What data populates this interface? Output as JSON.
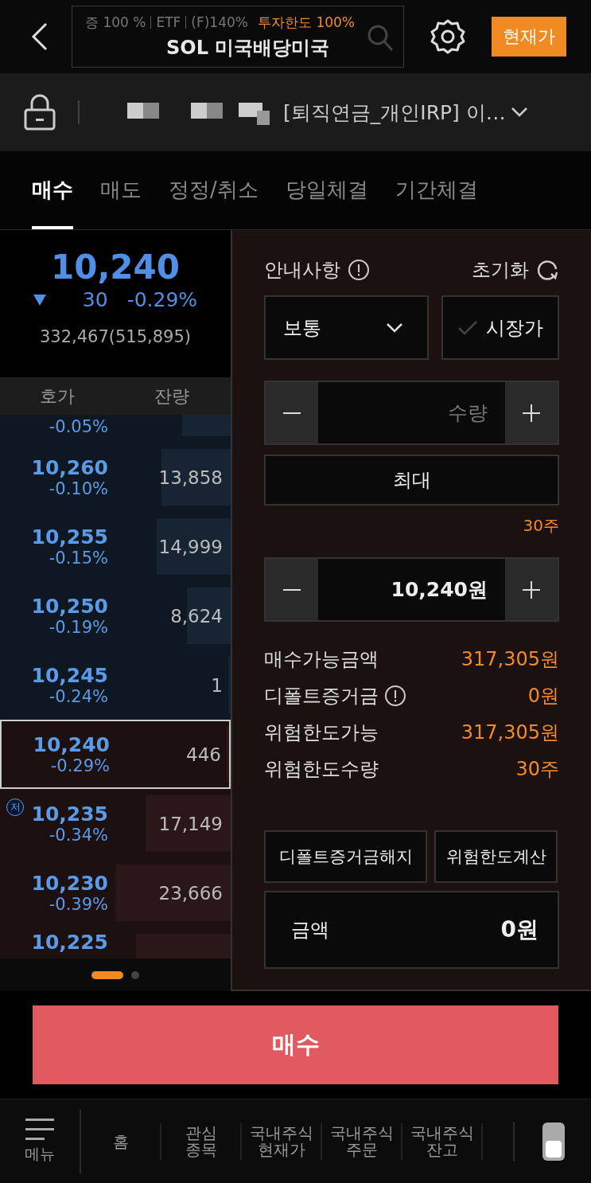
{
  "header": {
    "info": [
      "증 100 %",
      "ETF",
      "(F)140%"
    ],
    "limit": "투자한도 100%",
    "stock_name": "SOL 미국배당미국",
    "current_price_button": "현재가"
  },
  "account": {
    "masked": true,
    "name": "[퇴직연금_개인IRP] 이…"
  },
  "tabs": [
    {
      "label": "매수",
      "selected": true
    },
    {
      "label": "매도",
      "selected": false
    },
    {
      "label": "정정/취소",
      "selected": false
    },
    {
      "label": "당일체결",
      "selected": false
    },
    {
      "label": "기간체결",
      "selected": false
    }
  ],
  "quote": {
    "price": "10,240",
    "change": "30",
    "change_rate": "-0.29%",
    "volume": "332,467(515,895)"
  },
  "orderbook": {
    "columns": [
      "호가",
      "잔량"
    ],
    "rows": [
      {
        "kind": "ask",
        "pct": "-0.05%",
        "level": 0.21,
        "selected": false
      },
      {
        "kind": "ask",
        "price": "10,260",
        "pct": "-0.10%",
        "volume": "13,858",
        "level": 0.3,
        "selected": false
      },
      {
        "kind": "ask",
        "price": "10,255",
        "pct": "-0.15%",
        "volume": "14,999",
        "level": 0.32,
        "selected": false
      },
      {
        "kind": "ask",
        "price": "10,250",
        "pct": "-0.19%",
        "volume": "8,624",
        "level": 0.19,
        "selected": false
      },
      {
        "kind": "ask",
        "price": "10,245",
        "pct": "-0.24%",
        "volume": "1",
        "level": 0.01,
        "selected": false
      },
      {
        "kind": "bid",
        "price": "10,240",
        "pct": "-0.29%",
        "volume": "446",
        "level": 0.01,
        "selected": true
      },
      {
        "kind": "bid",
        "badge": "저",
        "price": "10,235",
        "pct": "-0.34%",
        "volume": "17,149",
        "level": 0.37,
        "selected": false
      },
      {
        "kind": "bid",
        "price": "10,230",
        "pct": "-0.39%",
        "volume": "23,666",
        "level": 0.5,
        "selected": false
      },
      {
        "kind": "bid",
        "price": "10,225",
        "level": 0.41,
        "selected": false
      }
    ]
  },
  "pager": [
    {
      "selected": true
    },
    {
      "selected": false
    }
  ],
  "order": {
    "notice": "안내사항",
    "reset": "초기화",
    "order_type": "보통",
    "market_price": {
      "label": "시장가",
      "checked": false
    },
    "quantity": {
      "placeholder": "수량"
    },
    "max_button": "최대",
    "max_quantity": "30주",
    "price": {
      "value": "10,240원"
    },
    "info": [
      {
        "label": "매수가능금액",
        "value": "317,305원",
        "info_icon": false
      },
      {
        "label": "디폴트증거금",
        "value": "0원",
        "info_icon": true
      },
      {
        "label": "위험한도가능",
        "value": "317,305원",
        "info_icon": false
      },
      {
        "label": "위험한도수량",
        "value": "30주",
        "info_icon": false
      }
    ],
    "buttons": [
      "디폴트증거금해지",
      "위험한도계산"
    ],
    "amount": {
      "label": "금액",
      "value": "0원"
    }
  },
  "submit": "매수",
  "bottom_nav": {
    "menu": "메뉴",
    "items": [
      "홈",
      "관심\n종목",
      "국내주식\n현재가",
      "국내주식\n주문",
      "국내주식\n잔고"
    ]
  }
}
